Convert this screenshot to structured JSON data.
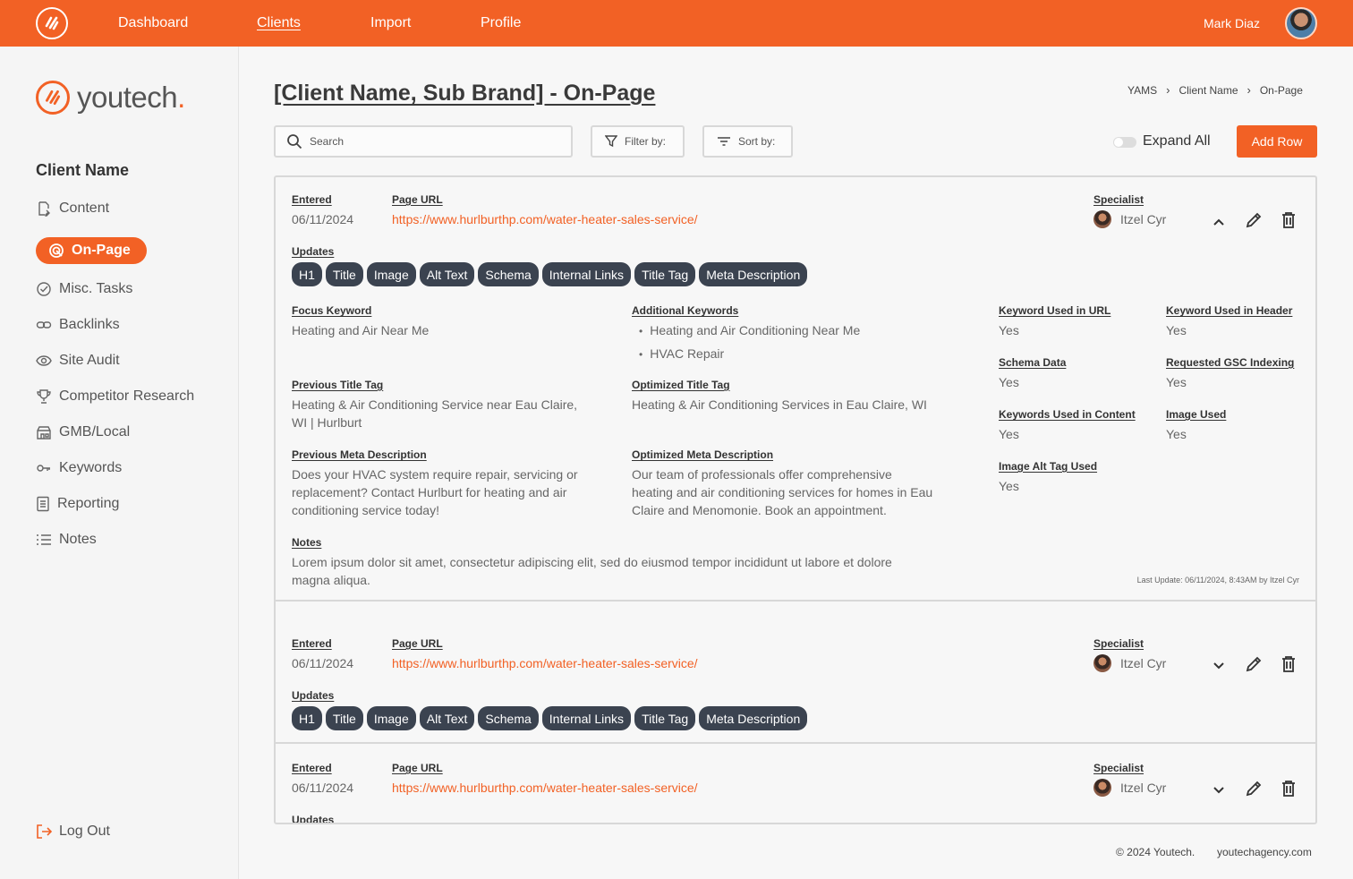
{
  "topbar": {
    "nav": [
      "Dashboard",
      "Clients",
      "Import",
      "Profile"
    ],
    "user_name": "Mark Diaz"
  },
  "sidebar": {
    "brand": "youtech",
    "brand_dot": ".",
    "client_heading": "Client Name",
    "items": [
      {
        "label": "Content",
        "icon": "document-edit-icon"
      },
      {
        "label": "On-Page",
        "icon": "target-icon",
        "active": true
      },
      {
        "label": "Misc. Tasks",
        "icon": "check-circle-icon"
      },
      {
        "label": "Backlinks",
        "icon": "link-icon"
      },
      {
        "label": "Site Audit",
        "icon": "eye-icon"
      },
      {
        "label": "Competitor Research",
        "icon": "trophy-icon"
      },
      {
        "label": "GMB/Local",
        "icon": "store-icon"
      },
      {
        "label": "Keywords",
        "icon": "key-icon"
      },
      {
        "label": "Reporting",
        "icon": "report-icon"
      },
      {
        "label": "Notes",
        "icon": "list-icon"
      }
    ],
    "logout": "Log Out"
  },
  "main": {
    "title": "[Client Name, Sub Brand] - On-Page",
    "breadcrumb": [
      "YAMS",
      "Client Name",
      "On-Page"
    ],
    "search_placeholder": "Search",
    "filter_label": "Filter by:",
    "sort_label": "Sort by:",
    "expand_all": "Expand All",
    "add_row": "Add Row"
  },
  "labels": {
    "entered": "Entered",
    "page_url": "Page URL",
    "specialist": "Specialist",
    "updates": "Updates",
    "focus_keyword": "Focus Keyword",
    "additional_keywords": "Additional Keywords",
    "previous_title": "Previous Title Tag",
    "optimized_title": "Optimized Title Tag",
    "previous_meta": "Previous Meta Description",
    "optimized_meta": "Optimized Meta Description",
    "notes": "Notes",
    "kw_in_url": "Keyword Used in URL",
    "kw_in_header": "Keyword Used in Header",
    "schema_data": "Schema Data",
    "requested_gsc": "Requested GSC Indexing",
    "kw_in_content": "Keywords Used in Content",
    "image_used": "Image Used",
    "image_alt": "Image Alt Tag Used"
  },
  "rows": [
    {
      "entered": "06/11/2024",
      "url": "https://www.hurlburthp.com/water-heater-sales-service/",
      "specialist": "Itzel Cyr",
      "tags": [
        "H1",
        "Title",
        "Image",
        "Alt Text",
        "Schema",
        "Internal Links",
        "Title Tag",
        "Meta Description"
      ],
      "expanded": true,
      "focus_keyword": "Heating and Air Near Me",
      "additional_keywords": [
        "Heating and Air Conditioning Near Me",
        "HVAC Repair"
      ],
      "previous_title": "Heating & Air Conditioning Service near Eau Claire, WI | Hurlburt",
      "optimized_title": "Heating & Air Conditioning Services in Eau Claire, WI",
      "previous_meta": "Does your HVAC system require repair, servicing or replacement? Contact Hurlburt for heating and air conditioning service today!",
      "optimized_meta": "Our team of professionals offer comprehensive heating and air conditioning services for homes in Eau Claire and Menomonie. Book an appointment.",
      "notes": "Lorem ipsum dolor sit amet, consectetur adipiscing elit, sed do eiusmod tempor incididunt ut labore et dolore magna aliqua.",
      "kw_in_url": "Yes",
      "kw_in_header": "Yes",
      "schema_data": "Yes",
      "requested_gsc": "Yes",
      "kw_in_content": "Yes",
      "image_used": "Yes",
      "image_alt": "Yes",
      "last_update": "Last Update: 06/11/2024, 8:43AM by Itzel Cyr"
    },
    {
      "entered": "06/11/2024",
      "url": "https://www.hurlburthp.com/water-heater-sales-service/",
      "specialist": "Itzel Cyr",
      "tags": [
        "H1",
        "Title",
        "Image",
        "Alt Text",
        "Schema",
        "Internal Links",
        "Title Tag",
        "Meta Description"
      ],
      "expanded": false
    },
    {
      "entered": "06/11/2024",
      "url": "https://www.hurlburthp.com/water-heater-sales-service/",
      "specialist": "Itzel Cyr",
      "expanded": false
    }
  ],
  "footer": {
    "copyright": "© 2024 Youtech.",
    "site": "youtechagency.com"
  },
  "colors": {
    "accent": "#f26125",
    "tag_bg": "#3b4350"
  }
}
